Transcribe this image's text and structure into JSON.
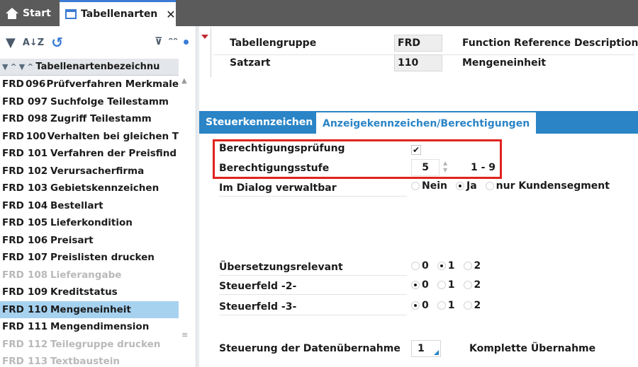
{
  "top_tabs": {
    "start_label": "Start",
    "active_label": "Tabellenarten",
    "close_glyph": "✕"
  },
  "left_toolbar": {
    "icons": [
      "filter-icon",
      "sort-az-icon",
      "refresh-icon",
      "filter-clear-icon",
      "binoculars-icon",
      "dot-icon"
    ]
  },
  "list": {
    "header": "Tabellenartenbezeichnu",
    "rows": [
      {
        "grp": "FRD",
        "num": "096",
        "name": "Prüfverfahren Merkmale",
        "selected": false,
        "disabled": false
      },
      {
        "grp": "FRD",
        "num": "097",
        "name": "Suchfolge Teilestamm",
        "selected": false,
        "disabled": false
      },
      {
        "grp": "FRD",
        "num": "098",
        "name": "Zugriff Teilestamm",
        "selected": false,
        "disabled": false
      },
      {
        "grp": "FRD",
        "num": "100",
        "name": "Verhalten bei gleichen T",
        "selected": false,
        "disabled": false
      },
      {
        "grp": "FRD",
        "num": "101",
        "name": "Verfahren der Preisfind",
        "selected": false,
        "disabled": false
      },
      {
        "grp": "FRD",
        "num": "102",
        "name": "Verursacherfirma",
        "selected": false,
        "disabled": false
      },
      {
        "grp": "FRD",
        "num": "103",
        "name": "Gebietskennzeichen",
        "selected": false,
        "disabled": false
      },
      {
        "grp": "FRD",
        "num": "104",
        "name": "Bestellart",
        "selected": false,
        "disabled": false
      },
      {
        "grp": "FRD",
        "num": "105",
        "name": "Lieferkondition",
        "selected": false,
        "disabled": false
      },
      {
        "grp": "FRD",
        "num": "106",
        "name": "Preisart",
        "selected": false,
        "disabled": false
      },
      {
        "grp": "FRD",
        "num": "107",
        "name": "Preislisten drucken",
        "selected": false,
        "disabled": false
      },
      {
        "grp": "FRD",
        "num": "108",
        "name": "Lieferangabe",
        "selected": false,
        "disabled": true
      },
      {
        "grp": "FRD",
        "num": "109",
        "name": "Kreditstatus",
        "selected": false,
        "disabled": false
      },
      {
        "grp": "FRD",
        "num": "110",
        "name": "Mengeneinheit",
        "selected": true,
        "disabled": false
      },
      {
        "grp": "FRD",
        "num": "111",
        "name": "Mengendimension",
        "selected": false,
        "disabled": false
      },
      {
        "grp": "FRD",
        "num": "112",
        "name": "Teilegruppe drucken",
        "selected": false,
        "disabled": true
      },
      {
        "grp": "FRD",
        "num": "113",
        "name": "Textbaustein",
        "selected": false,
        "disabled": true
      }
    ]
  },
  "header": {
    "tabellengruppe_label": "Tabellengruppe",
    "tabellengruppe_value": "FRD",
    "tabellengruppe_desc": "Function Reference Description",
    "satzart_label": "Satzart",
    "satzart_value": "110",
    "satzart_desc": "Mengeneinheit"
  },
  "tabs": {
    "steuer": "Steuerkennzeichen",
    "anzeige": "Anzeigekennzeichen/Berechtigungen"
  },
  "fields": {
    "berechtigungspruefung_label": "Berechtigungsprüfung",
    "berechtigungspruefung_checked": true,
    "checkmark": "✔",
    "berechtigungsstufe_label": "Berechtigungsstufe",
    "berechtigungsstufe_value": "5",
    "berechtigungsstufe_range": "1 - 9",
    "dialog_label": "Im Dialog verwaltbar",
    "dialog_options": [
      "Nein",
      "Ja",
      "nur Kundensegment"
    ],
    "dialog_selected": "Ja",
    "uebersetzung_label": "Übersetzungsrelevant",
    "uebersetzung_options": [
      "0",
      "1",
      "2"
    ],
    "uebersetzung_selected": "1",
    "steuerfeld2_label": "Steuerfeld -2-",
    "steuerfeld2_options": [
      "0",
      "1",
      "2"
    ],
    "steuerfeld2_selected": "0",
    "steuerfeld3_label": "Steuerfeld -3-",
    "steuerfeld3_options": [
      "0",
      "1",
      "2"
    ],
    "steuerfeld3_selected": "0",
    "datenuebernahme_label": "Steuerung der Datenübernahme",
    "datenuebernahme_value": "1",
    "datenuebernahme_desc": "Komplette Übernahme"
  },
  "colors": {
    "accent": "#2a84c6",
    "selection": "#a6d2f0",
    "highlight_box": "#e0231e",
    "topbar": "#5b5b5b"
  }
}
